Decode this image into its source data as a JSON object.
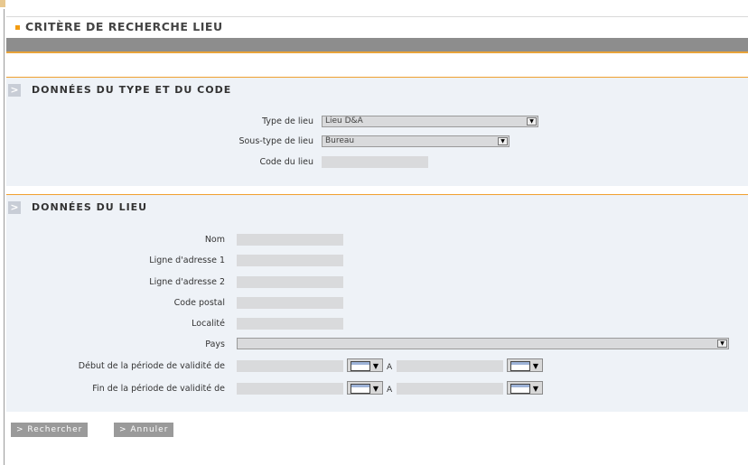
{
  "header": {
    "title": "CRITÈRE DE RECHERCHE LIEU"
  },
  "section1": {
    "title": "DONNÉES DU TYPE ET DU CODE",
    "type_label": "Type de lieu",
    "type_value": "Lieu D&A",
    "subtype_label": "Sous-type de lieu",
    "subtype_value": "Bureau",
    "code_label": "Code du lieu",
    "code_value": ""
  },
  "section2": {
    "title": "DONNÉES DU LIEU",
    "nom_label": "Nom",
    "addr1_label": "Ligne d'adresse 1",
    "addr2_label": "Ligne d'adresse 2",
    "postal_label": "Code postal",
    "localite_label": "Localité",
    "pays_label": "Pays",
    "pays_value": "",
    "debut_label": "Début de la période de validité de",
    "fin_label": "Fin de la période de validité de",
    "range_sep": "A"
  },
  "buttons": {
    "search": "> Rechercher",
    "cancel": "> Annuler"
  },
  "colors": {
    "accent": "#f39c12",
    "section_bg": "#eef2f7",
    "field_bg": "#d9dadc"
  }
}
